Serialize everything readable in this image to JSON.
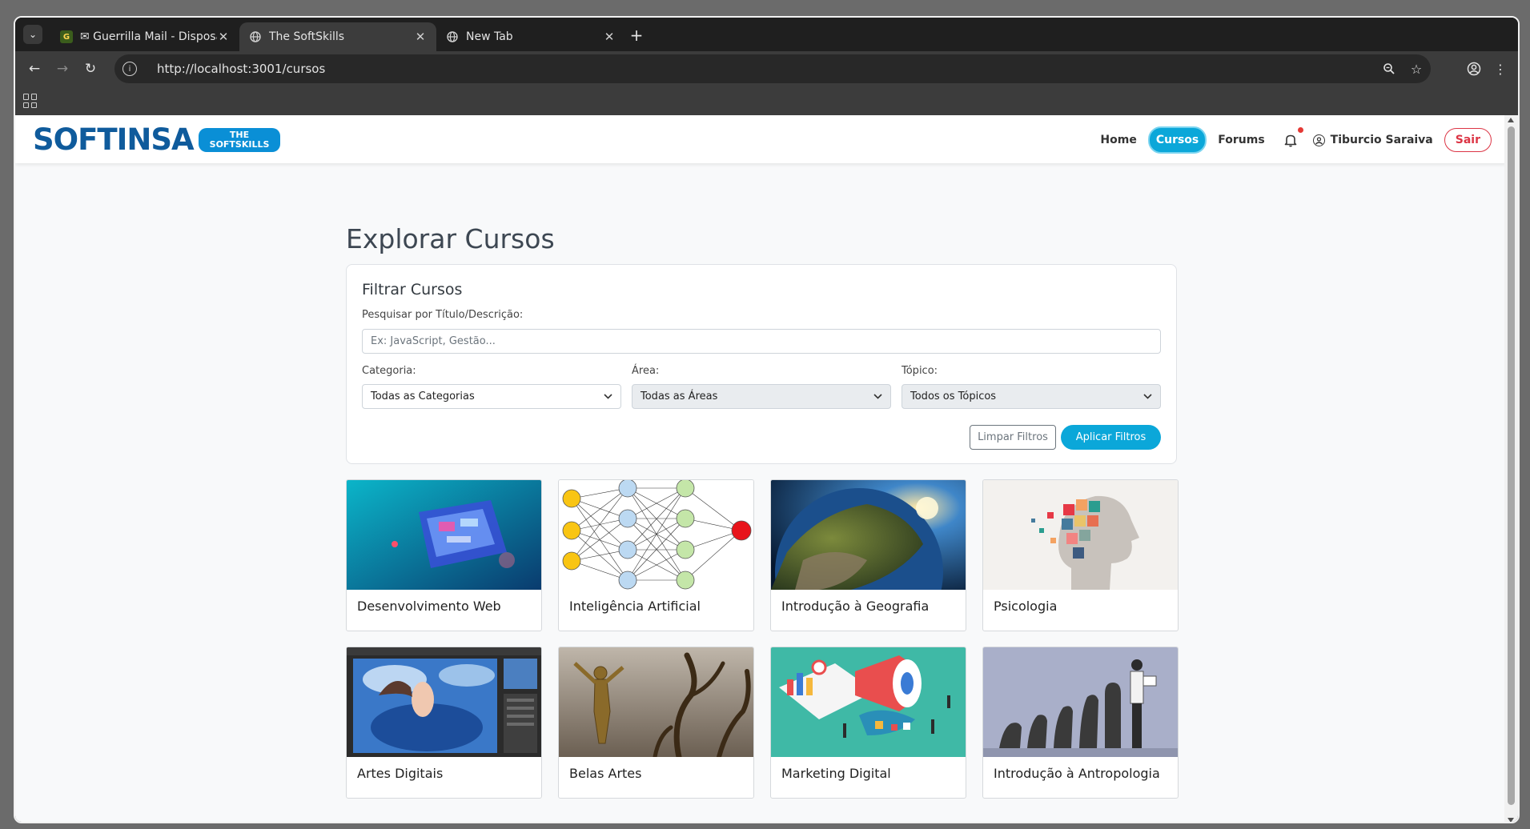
{
  "browser": {
    "tabs": [
      {
        "title": "✉ Guerrilla Mail - Disposa",
        "favicon": "G",
        "active": false
      },
      {
        "title": "The SoftSkills",
        "favicon": "globe-icon",
        "active": true
      },
      {
        "title": "New Tab",
        "favicon": "globe-icon",
        "active": false
      }
    ],
    "url": "http://localhost:3001/cursos"
  },
  "app": {
    "logo_word": "SOFTINSA",
    "logo_badge_line1": "THE",
    "logo_badge_line2": "SOFTSKILLS",
    "nav": {
      "home": "Home",
      "cursos": "Cursos",
      "forums": "Forums",
      "user_name": "Tiburcio Saraiva",
      "logout": "Sair"
    },
    "accent_color": "#0ba7d9",
    "brand_color": "#0f5b9c"
  },
  "main": {
    "title": "Explorar Cursos",
    "filter": {
      "title": "Filtrar Cursos",
      "search_label": "Pesquisar por Título/Descrição:",
      "search_placeholder": "Ex: JavaScript, Gestão...",
      "categoria_label": "Categoria:",
      "categoria_value": "Todas as Categorias",
      "area_label": "Área:",
      "area_value": "Todas as Áreas",
      "topico_label": "Tópico:",
      "topico_value": "Todos os Tópicos",
      "clear_label": "Limpar Filtros",
      "apply_label": "Aplicar Filtros"
    },
    "courses": [
      {
        "name": "Desenvolvimento Web"
      },
      {
        "name": "Inteligência Artificial"
      },
      {
        "name": "Introdução à Geografia"
      },
      {
        "name": "Psicologia"
      },
      {
        "name": "Artes Digitais"
      },
      {
        "name": "Belas Artes"
      },
      {
        "name": "Marketing Digital"
      },
      {
        "name": "Introdução à Antropologia"
      }
    ]
  }
}
